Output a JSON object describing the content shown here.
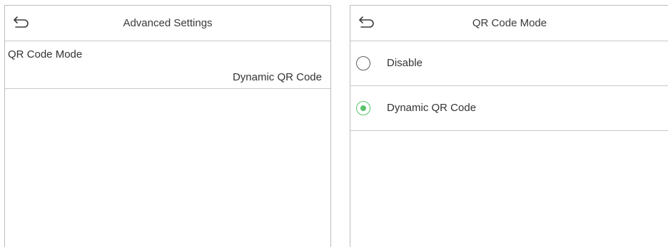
{
  "left_screen": {
    "title": "Advanced Settings",
    "back_icon": "back-arrow-icon",
    "settings": [
      {
        "label": "QR Code Mode",
        "value": "Dynamic QR Code"
      }
    ]
  },
  "right_screen": {
    "title": "QR Code Mode",
    "back_icon": "back-arrow-icon",
    "options": [
      {
        "label": "Disable",
        "selected": false
      },
      {
        "label": "Dynamic QR Code",
        "selected": true
      }
    ]
  },
  "colors": {
    "accent_green": "#5cc16b",
    "divider": "#c8c8c8",
    "text": "#333333"
  }
}
